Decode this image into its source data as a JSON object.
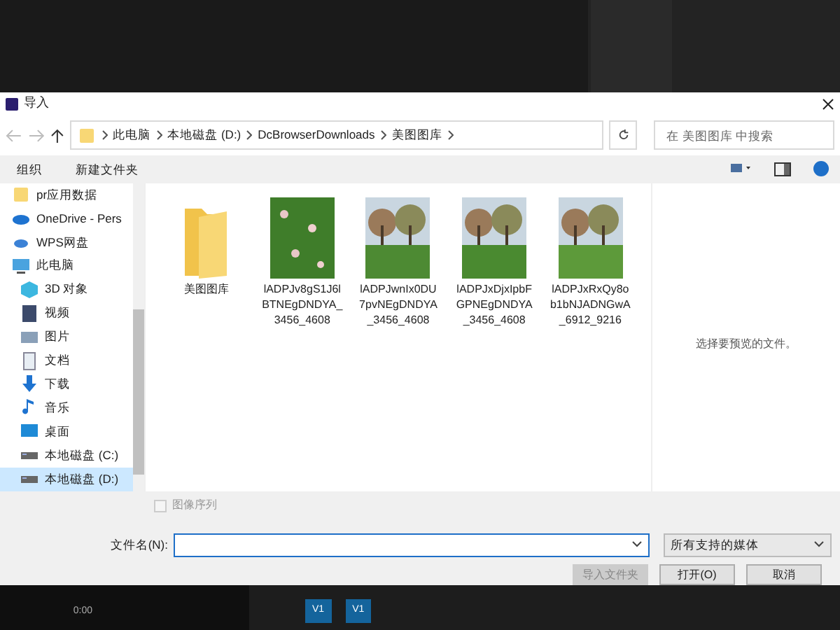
{
  "window": {
    "title": "导入"
  },
  "breadcrumb": [
    "此电脑",
    "本地磁盘 (D:)",
    "DcBrowserDownloads",
    "美图图库"
  ],
  "search": {
    "placeholder": "在 美图图库 中搜索"
  },
  "toolbar": [
    "组织",
    "新建文件夹"
  ],
  "sidebar": {
    "items": [
      {
        "label": "pr应用数据",
        "selected": false
      },
      {
        "label": "OneDrive - Pers",
        "selected": false
      },
      {
        "label": "WPS网盘",
        "selected": false
      },
      {
        "label": "此电脑",
        "selected": false,
        "children": [
          {
            "label": "3D 对象",
            "selected": false
          },
          {
            "label": "视频",
            "selected": false
          },
          {
            "label": "图片",
            "selected": false
          },
          {
            "label": "文档",
            "selected": false
          },
          {
            "label": "下载",
            "selected": false
          },
          {
            "label": "音乐",
            "selected": false
          },
          {
            "label": "桌面",
            "selected": false
          },
          {
            "label": "本地磁盘 (C:)",
            "selected": false
          },
          {
            "label": "本地磁盘 (D:)",
            "selected": true
          }
        ]
      }
    ]
  },
  "files": [
    {
      "kind": "folder",
      "name": "美图图库"
    },
    {
      "kind": "picture",
      "name": "lADPJv8gS1J6lBTNEgDNDYA_3456_4608"
    },
    {
      "kind": "picture",
      "name": "lADPJwnIx0DU7pvNEgDNDYA_3456_4608"
    },
    {
      "kind": "picture",
      "name": "lADPJxDjxIpbFGPNEgDNDYA_3456_4608"
    },
    {
      "kind": "picture",
      "name": "lADPJxRxQy8ob1bNJADNGwA_6912_9216"
    }
  ],
  "preview": {
    "message": "选择要预览的文件。"
  },
  "sequence": {
    "label": "图像序列",
    "checked": false,
    "disabled": true
  },
  "filename": {
    "label": "文件名(N):"
  },
  "filetype": {
    "value": "所有支持的媒体"
  },
  "buttons": [
    {
      "label": "导入文件夹",
      "disabled": true
    },
    {
      "label": "打开(O)",
      "disabled": false
    },
    {
      "label": "取消",
      "disabled": false
    }
  ],
  "background": {
    "time": "0:00",
    "tracks": [
      "V1",
      "V1"
    ]
  }
}
